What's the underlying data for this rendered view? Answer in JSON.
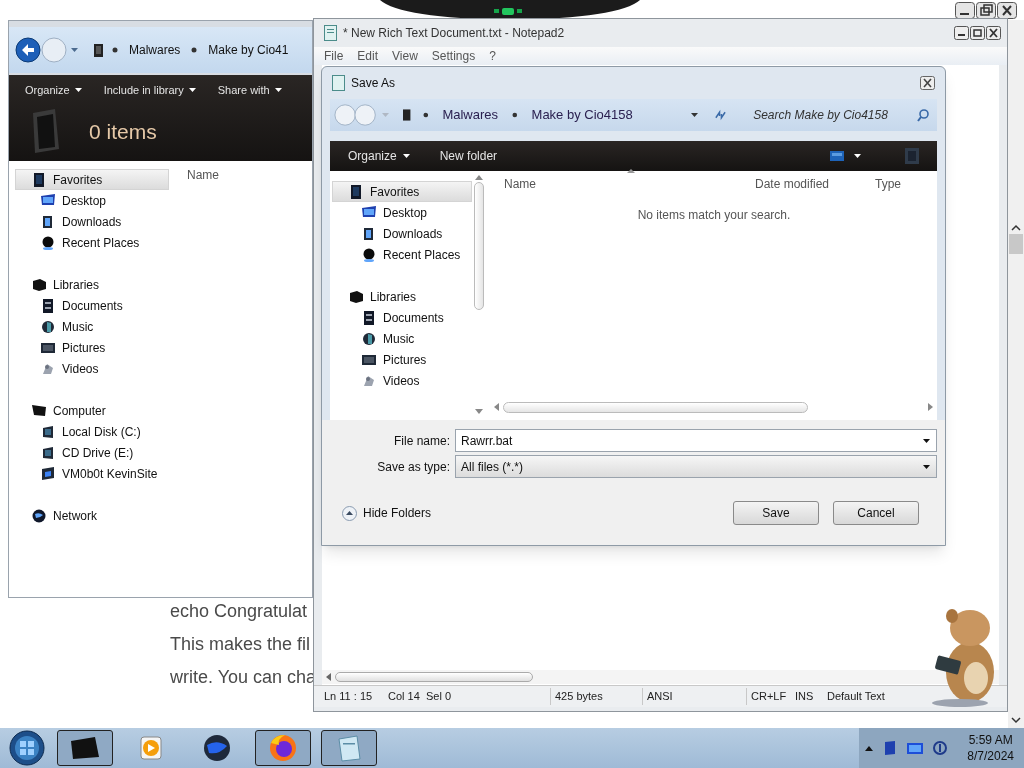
{
  "browser_page": {
    "lines": [
      "echo Congratulat",
      "This makes the fil",
      "write. You can cha"
    ]
  },
  "explorer": {
    "breadcrumb": [
      "Malwares",
      "Make by Cio41"
    ],
    "toolbar": [
      "Organize",
      "Include in library",
      "Share with"
    ],
    "item_count": "0 items",
    "column": "Name",
    "nav": [
      {
        "label": "Favorites",
        "kind": "favorites",
        "selected": true,
        "children": [
          {
            "label": "Desktop",
            "kind": "desktop",
            "selected": false
          },
          {
            "label": "Downloads",
            "kind": "downloads",
            "selected": false
          },
          {
            "label": "Recent Places",
            "kind": "recent",
            "selected": false
          }
        ]
      },
      {
        "label": "Libraries",
        "kind": "libraries",
        "selected": false,
        "children": [
          {
            "label": "Documents",
            "kind": "documents",
            "selected": false
          },
          {
            "label": "Music",
            "kind": "music",
            "selected": false
          },
          {
            "label": "Pictures",
            "kind": "pictures",
            "selected": false
          },
          {
            "label": "Videos",
            "kind": "videos",
            "selected": false
          }
        ]
      },
      {
        "label": "Computer",
        "kind": "computer",
        "selected": false,
        "children": [
          {
            "label": "Local Disk (C:)",
            "kind": "disk",
            "selected": false
          },
          {
            "label": "CD Drive (E:)",
            "kind": "disk",
            "selected": false
          },
          {
            "label": "VM0b0t KevinSite",
            "kind": "network-drive",
            "selected": false
          }
        ]
      },
      {
        "label": "Network",
        "kind": "network",
        "selected": false
      }
    ]
  },
  "notepad": {
    "title": "* New Rich Text Document.txt - Notepad2",
    "menu": [
      "File",
      "Edit",
      "View",
      "Settings",
      "?"
    ],
    "status": [
      "Ln 11 : 15",
      "Col 14",
      "Sel 0",
      "425 bytes",
      "ANSI",
      "CR+LF",
      "INS",
      "Default Text"
    ]
  },
  "save_dialog": {
    "title": "Save As",
    "breadcrumb": [
      "Malwares",
      "Make by Cio4158"
    ],
    "search": {
      "placeholder": "Search Make by Cio4158"
    },
    "toolbar": [
      "Organize",
      "New folder"
    ],
    "nav": [
      {
        "label": "Favorites",
        "kind": "favorites",
        "selected": true,
        "children": [
          {
            "label": "Desktop",
            "kind": "desktop",
            "selected": false
          },
          {
            "label": "Downloads",
            "kind": "downloads",
            "selected": false
          },
          {
            "label": "Recent Places",
            "kind": "recent",
            "selected": false
          }
        ]
      },
      {
        "label": "Libraries",
        "kind": "libraries",
        "selected": false,
        "children": [
          {
            "label": "Documents",
            "kind": "documents",
            "selected": false
          },
          {
            "label": "Music",
            "kind": "music",
            "selected": false
          },
          {
            "label": "Pictures",
            "kind": "pictures",
            "selected": false
          },
          {
            "label": "Videos",
            "kind": "videos",
            "selected": false
          }
        ]
      }
    ],
    "columns": [
      "Name",
      "Date modified",
      "Type"
    ],
    "empty_message": "No items match your search.",
    "file_name": {
      "label": "File name:",
      "value": "Rawrr.bat"
    },
    "save_as_type": {
      "label": "Save as type:",
      "value": "All files (*.*)"
    },
    "hide_folders": "Hide Folders",
    "buttons": [
      "Save",
      "Cancel"
    ]
  },
  "taskbar": {
    "apps": [
      {
        "kind": "explorer"
      },
      {
        "kind": "media"
      },
      {
        "kind": "globe"
      },
      {
        "kind": "browser"
      },
      {
        "kind": "notepad"
      }
    ],
    "time": "5:59 AM",
    "date": "8/7/2024"
  }
}
